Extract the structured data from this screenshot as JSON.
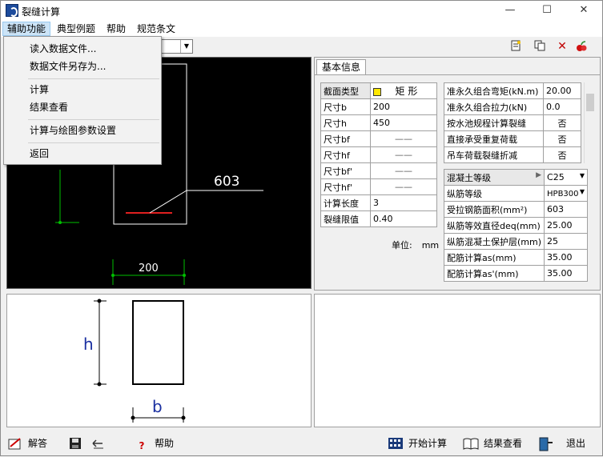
{
  "window": {
    "title": "裂缝计算",
    "minimize": "—",
    "maximize": "☐",
    "close": "✕"
  },
  "menubar": {
    "items": [
      "辅助功能",
      "典型例题",
      "帮助",
      "规范条文"
    ]
  },
  "dropdown": {
    "items": [
      "读入数据文件...",
      "数据文件另存为...",
      "计算",
      "结果查看",
      "计算与绘图参数设置",
      "返回"
    ]
  },
  "toolbar": {
    "icons": [
      "new-doc-icon",
      "copy-icon",
      "delete-icon",
      "fruit-icon"
    ],
    "delete_glyph": "✕"
  },
  "canvas": {
    "dim_value": "603",
    "dim_width": "200"
  },
  "panel": {
    "tab": "基本信息",
    "section_type_label": "截面类型",
    "section_type_value": "矩 形",
    "params": [
      {
        "label": "尺寸b",
        "value": "200"
      },
      {
        "label": "尺寸h",
        "value": "450"
      },
      {
        "label": "尺寸bf",
        "value": "——"
      },
      {
        "label": "尺寸hf",
        "value": "——"
      },
      {
        "label": "尺寸bf'",
        "value": "——"
      },
      {
        "label": "尺寸hf'",
        "value": "——"
      },
      {
        "label": "计算长度",
        "value": "3"
      },
      {
        "label": "裂缝限值",
        "value": "0.40"
      }
    ],
    "loads": [
      {
        "label": "准永久组合弯矩(kN.m)",
        "value": "20.00"
      },
      {
        "label": "准永久组合拉力(kN)",
        "value": "0.0"
      },
      {
        "label": "按水池规程计算裂缝",
        "value": "否"
      },
      {
        "label": "直接承受重复荷载",
        "value": "否"
      },
      {
        "label": "吊车荷载裂缝折减",
        "value": "否"
      }
    ],
    "materials": [
      {
        "label": "混凝土等级",
        "value": "C25"
      },
      {
        "label": "纵筋等级",
        "value": "HPB300"
      },
      {
        "label": "受拉钢筋面积(mm²)",
        "value": "603"
      },
      {
        "label": "纵筋等效直径deq(mm)",
        "value": "25.00"
      },
      {
        "label": "纵筋混凝土保护层(mm)",
        "value": "25"
      },
      {
        "label": "配筋计算as(mm)",
        "value": "35.00"
      },
      {
        "label": "配筋计算as'(mm)",
        "value": "35.00"
      }
    ],
    "unit_label": "单位:",
    "unit_value": "mm"
  },
  "diagram": {
    "h_label": "h",
    "b_label": "b"
  },
  "statusbar": {
    "answer": "解答",
    "help": "帮助",
    "start_calc": "开始计算",
    "view_result": "结果查看",
    "exit": "退出"
  },
  "colors": {
    "canvas_bg": "#000000",
    "dim_green": "#00c000",
    "rebar_red": "#e02020",
    "label_blue": "#1a2fa0"
  }
}
